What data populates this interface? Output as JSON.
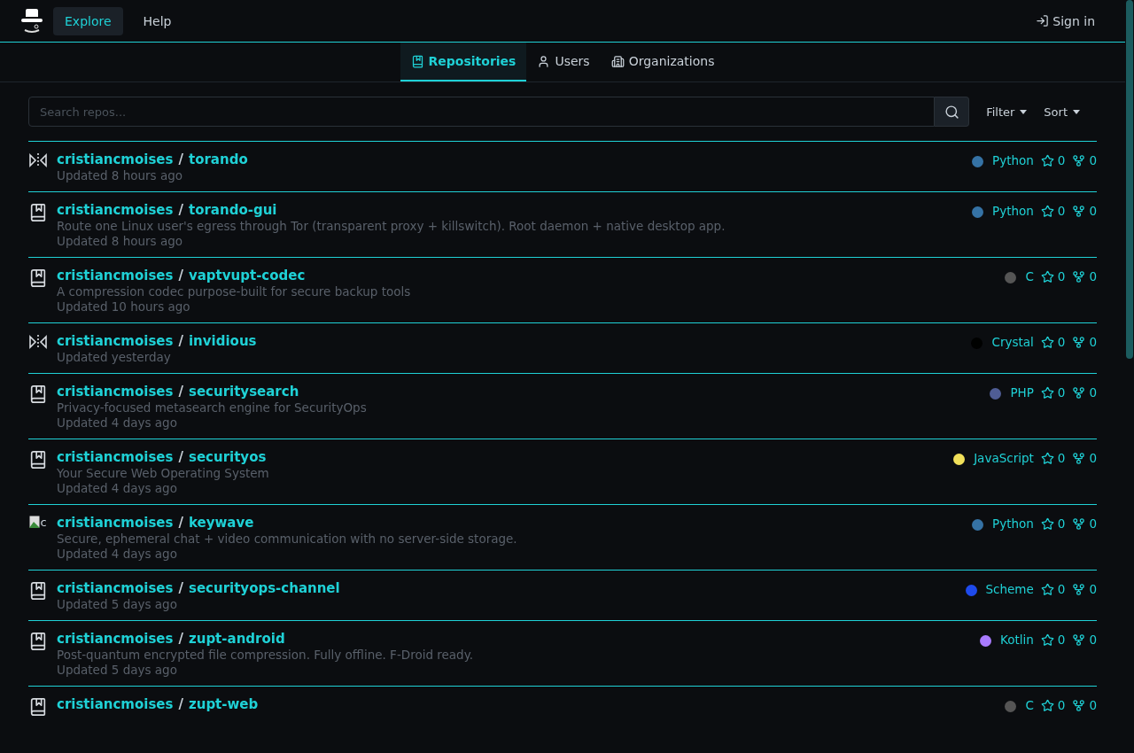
{
  "nav": {
    "items": [
      {
        "label": "Explore",
        "selected": true
      },
      {
        "label": "Help",
        "selected": false
      }
    ],
    "sign_in": "Sign in"
  },
  "tabs": [
    {
      "label": "Repositories",
      "selected": true
    },
    {
      "label": "Users",
      "selected": false
    },
    {
      "label": "Organizations",
      "selected": false
    }
  ],
  "search": {
    "placeholder": "Search repos..."
  },
  "filters": [
    "Filter",
    "Sort"
  ],
  "repos": [
    {
      "kind": "mirror",
      "owner": "cristiancmoises",
      "separator": "/",
      "name": "torando",
      "language": "Python",
      "color": "#3572a5",
      "stars": "0",
      "forks": "0",
      "updated": "Updated 8 hours ago"
    },
    {
      "kind": "repo",
      "owner": "cristiancmoises",
      "separator": "/",
      "name": "torando-gui",
      "description": "Route one Linux user's egress through Tor (transparent proxy + killswitch). Root daemon + native desktop app.",
      "language": "Python",
      "color": "#3572a5",
      "stars": "0",
      "forks": "0",
      "updated": "Updated 8 hours ago"
    },
    {
      "kind": "repo",
      "owner": "cristiancmoises",
      "separator": "/",
      "name": "vaptvupt-codec",
      "description": "A compression codec purpose-built for secure backup tools",
      "language": "C",
      "color": "#555555",
      "stars": "0",
      "forks": "0",
      "updated": "Updated 10 hours ago"
    },
    {
      "kind": "mirror",
      "owner": "cristiancmoises",
      "separator": "/",
      "name": "invidious",
      "language": "Crystal",
      "color": "#000100",
      "stars": "0",
      "forks": "0",
      "updated": "Updated yesterday"
    },
    {
      "kind": "repo",
      "owner": "cristiancmoises",
      "separator": "/",
      "name": "securitysearch",
      "description": "Privacy-focused metasearch engine for SecurityOps",
      "language": "PHP",
      "color": "#4f5d95",
      "stars": "0",
      "forks": "0",
      "updated": "Updated 4 days ago"
    },
    {
      "kind": "repo",
      "owner": "cristiancmoises",
      "separator": "/",
      "name": "securityos",
      "description": "Your Secure Web Operating System",
      "language": "JavaScript",
      "color": "#f1e05a",
      "stars": "0",
      "forks": "0",
      "updated": "Updated 4 days ago"
    },
    {
      "kind": "broken-image",
      "alt": "c",
      "owner": "cristiancmoises",
      "separator": "/",
      "name": "keywave",
      "description": "Secure, ephemeral chat + video communication with no server-side storage.",
      "language": "Python",
      "color": "#3572a5",
      "stars": "0",
      "forks": "0",
      "updated": "Updated 4 days ago"
    },
    {
      "kind": "repo",
      "owner": "cristiancmoises",
      "separator": "/",
      "name": "securityops-channel",
      "language": "Scheme",
      "color": "#1e4aec",
      "stars": "0",
      "forks": "0",
      "updated": "Updated 5 days ago"
    },
    {
      "kind": "repo",
      "owner": "cristiancmoises",
      "separator": "/",
      "name": "zupt-android",
      "description": "Post-quantum encrypted file compression. Fully offline. F-Droid ready.",
      "language": "Kotlin",
      "color": "#a97bff",
      "stars": "0",
      "forks": "0",
      "updated": "Updated 5 days ago"
    },
    {
      "kind": "repo",
      "owner": "cristiancmoises",
      "separator": "/",
      "name": "zupt-web",
      "language": "C",
      "color": "#555555",
      "stars": "0",
      "forks": "0"
    }
  ]
}
